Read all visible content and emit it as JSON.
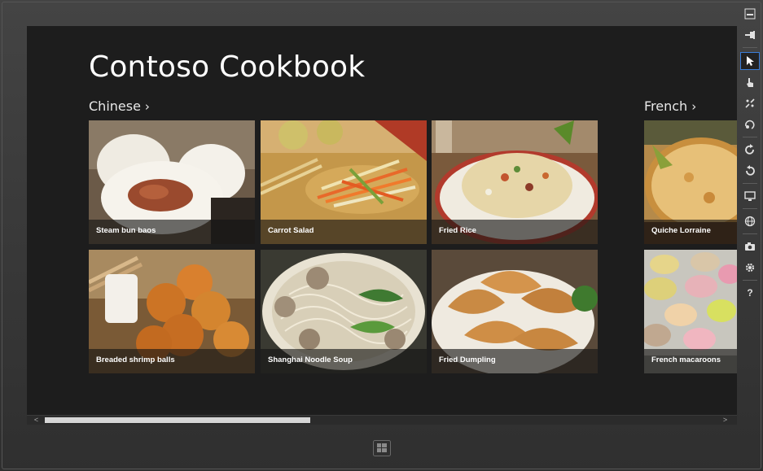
{
  "app": {
    "title": "Contoso Cookbook"
  },
  "groups": [
    {
      "title": "Chinese",
      "chevron": "›"
    },
    {
      "title": "French",
      "chevron": "›"
    }
  ],
  "tiles": {
    "steam_bun_baos": "Steam bun baos",
    "carrot_salad": "Carrot Salad",
    "fried_rice": "Fried Rice",
    "quiche_lorraine": "Quiche Lorraine",
    "breaded_shrimp_balls": "Breaded shrimp balls",
    "shanghai_noodle_soup": "Shanghai Noodle Soup",
    "fried_dumpling": "Fried Dumpling",
    "french_macaroons": "French macaroons"
  },
  "scrollbar": {
    "left_arrow": "<",
    "right_arrow": ">",
    "position_fraction": 0.0,
    "visible_fraction": 0.39
  },
  "toolbar_icons": [
    "minimize-icon",
    "pin-icon",
    "pointer-icon",
    "touch-icon",
    "pinch-zoom-icon",
    "rotate-touch-icon",
    "rotate-clockwise-icon",
    "rotate-counterclockwise-icon",
    "monitor-icon",
    "globe-icon",
    "camera-icon",
    "gear-icon",
    "help-icon"
  ],
  "toolbar": {
    "help_label": "?"
  },
  "colors": {
    "screen_bg": "#1d1d1d",
    "selection_border": "#3a7dd8",
    "text": "#ffffff"
  }
}
